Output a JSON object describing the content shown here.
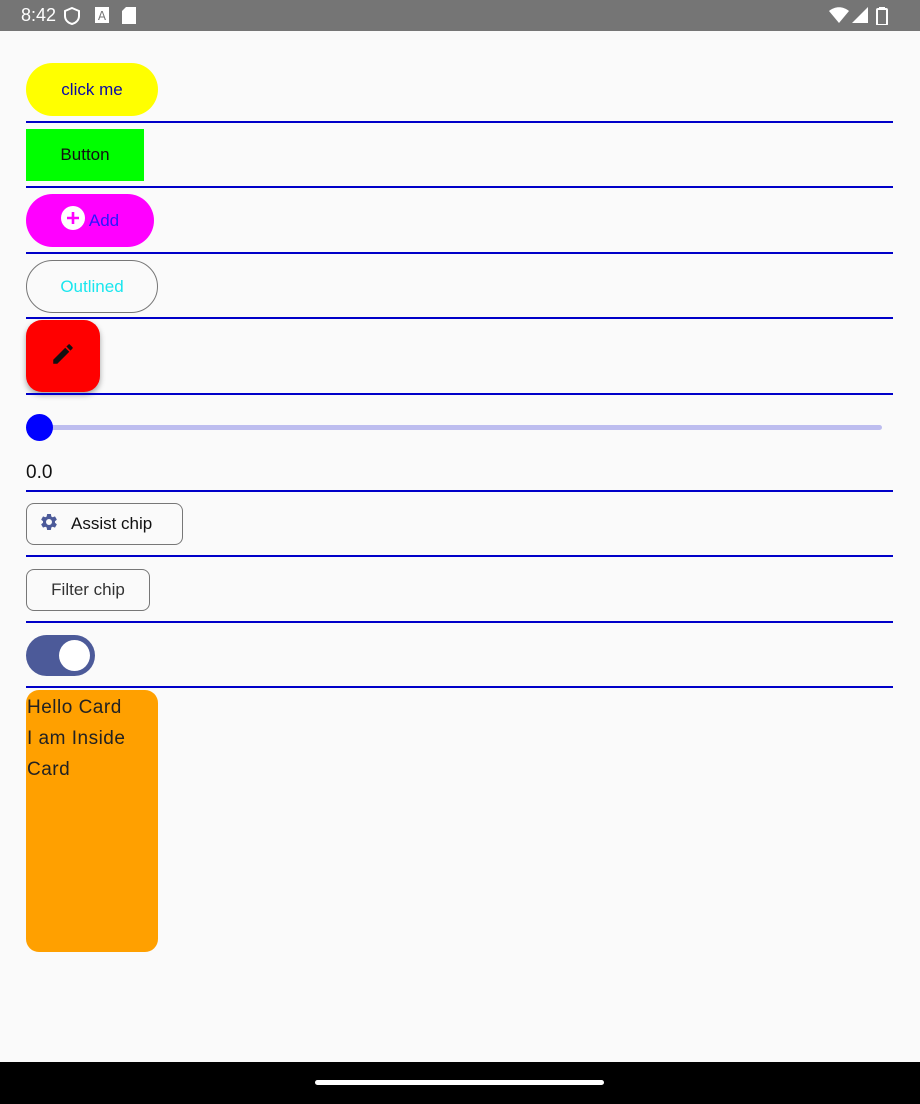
{
  "status_bar": {
    "time": "8:42",
    "left_icons": [
      "shield-icon",
      "a-badge-icon",
      "sd-card-icon"
    ],
    "right_icons": [
      "wifi-icon",
      "signal-icon",
      "battery-icon"
    ]
  },
  "buttons": {
    "click_me": "click me",
    "button": "Button",
    "add": "Add",
    "outlined": "Outlined",
    "fab_icon": "pencil-icon"
  },
  "slider": {
    "value": 0.0,
    "value_label": "0.0"
  },
  "chips": {
    "assist": "Assist chip",
    "assist_icon": "gear-icon",
    "filter": "Filter chip"
  },
  "switch": {
    "checked": true
  },
  "card": {
    "line1": "Hello Card",
    "line2": "I am Inside",
    "line3": "Card"
  },
  "colors": {
    "click_me_bg": "#ffff00",
    "button_bg": "#00ff00",
    "add_bg": "#ff00ff",
    "fab_bg": "#ff0000",
    "slider_accent": "#0000ff",
    "switch_track": "#4c5a99",
    "card_bg": "#ffa000",
    "divider": "#0000c8"
  }
}
